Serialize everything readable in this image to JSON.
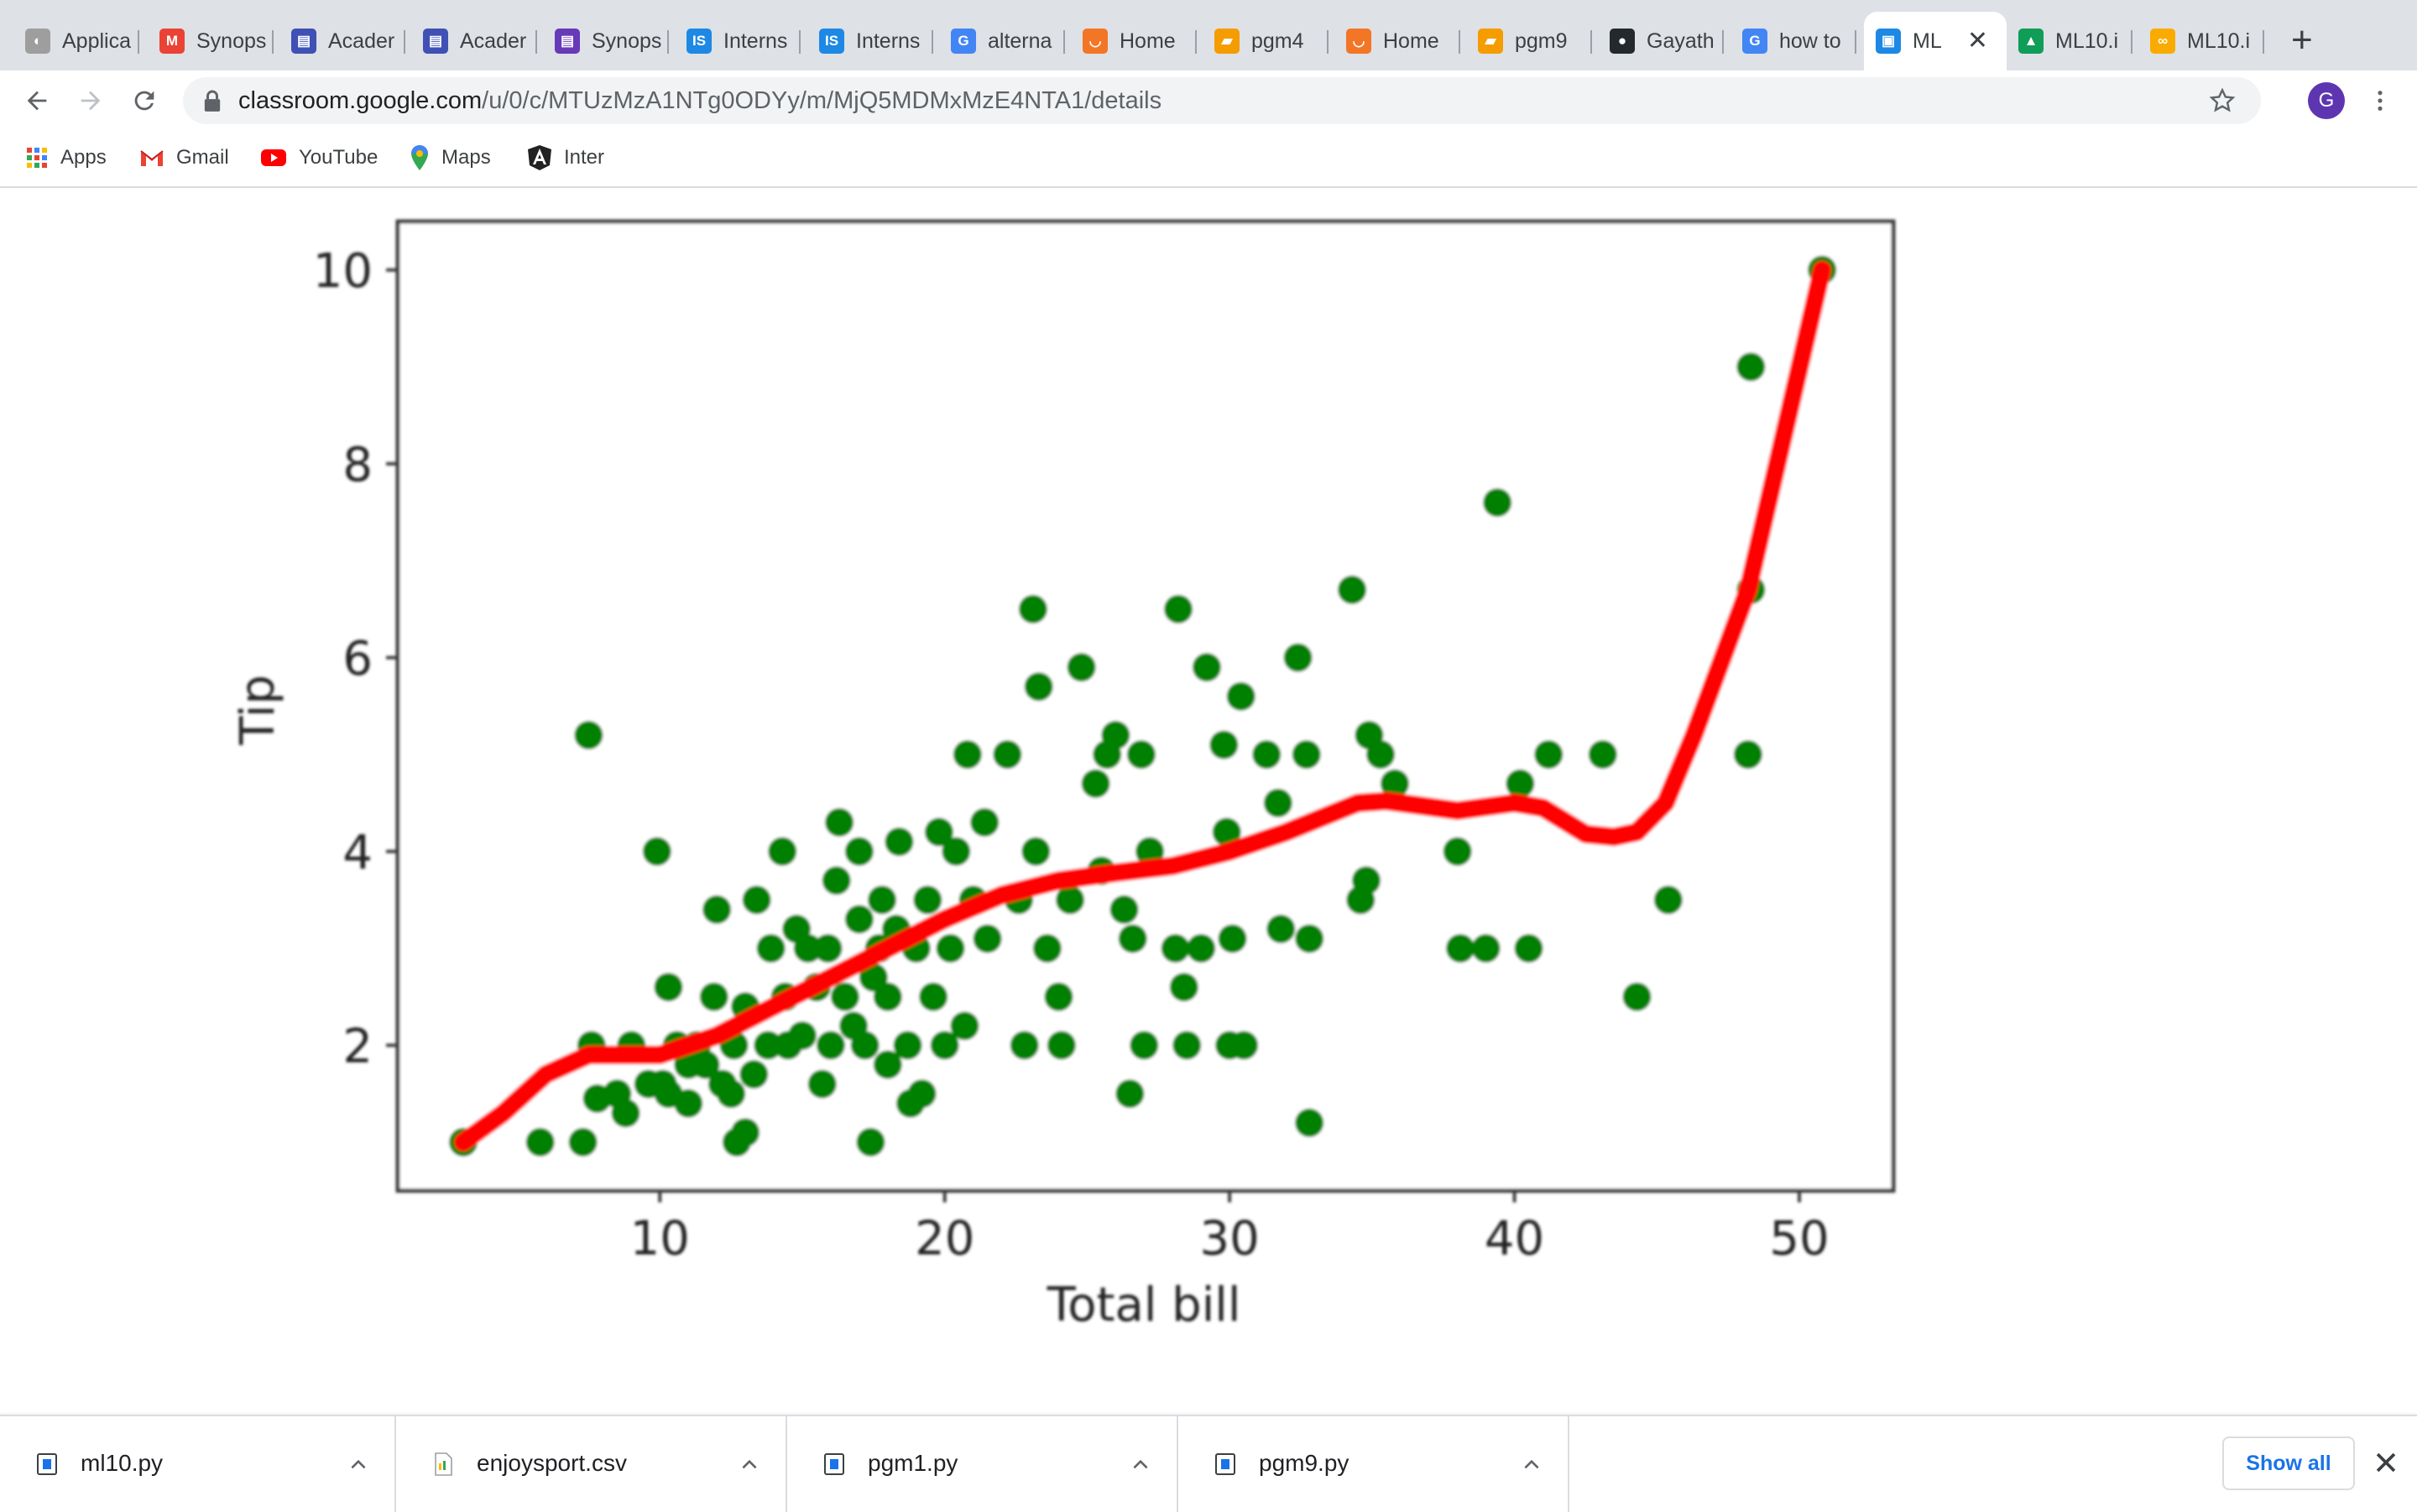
{
  "tabs": [
    {
      "label": "Applica",
      "icon": "applications-icon",
      "color": "#9e9e9e"
    },
    {
      "label": "Synops",
      "icon": "gmail-icon",
      "color": "#ea4335"
    },
    {
      "label": "Acader",
      "icon": "forms-icon",
      "color": "#3f51b5"
    },
    {
      "label": "Acader",
      "icon": "forms-icon",
      "color": "#3f51b5"
    },
    {
      "label": "Synops",
      "icon": "forms-icon",
      "color": "#673ab7"
    },
    {
      "label": "Interns",
      "icon": "internshala-icon",
      "color": "#1e88e5"
    },
    {
      "label": "Interns",
      "icon": "internshala-icon",
      "color": "#1e88e5"
    },
    {
      "label": "alterna",
      "icon": "google-icon",
      "color": "#4285f4"
    },
    {
      "label": "Home",
      "icon": "jupyter-icon",
      "color": "#f37626"
    },
    {
      "label": "pgm4",
      "icon": "notebook-icon",
      "color": "#f59c00"
    },
    {
      "label": "Home",
      "icon": "jupyter-icon",
      "color": "#f37626"
    },
    {
      "label": "pgm9",
      "icon": "notebook-icon",
      "color": "#f59c00"
    },
    {
      "label": "Gayath",
      "icon": "github-icon",
      "color": "#24292e"
    },
    {
      "label": "how to",
      "icon": "google-icon",
      "color": "#4285f4"
    },
    {
      "label": "ML",
      "icon": "classroom-icon",
      "color": "#1e88e5",
      "active": true
    },
    {
      "label": "ML10.i",
      "icon": "drive-icon",
      "color": "#0f9d58"
    },
    {
      "label": "ML10.i",
      "icon": "colab-icon",
      "color": "#f9ab00"
    }
  ],
  "address": {
    "host": "classroom.google.com",
    "path": "/u/0/c/MTUzMzA1NTg0ODYy/m/MjQ5MDMxMzE4NTA1/details"
  },
  "profile_initial": "G",
  "bookmarks": [
    {
      "label": "Apps",
      "icon": "apps-grid-icon"
    },
    {
      "label": "Gmail",
      "icon": "gmail-icon"
    },
    {
      "label": "YouTube",
      "icon": "youtube-icon"
    },
    {
      "label": "Maps",
      "icon": "maps-icon"
    },
    {
      "label": "Inter",
      "icon": "angular-icon"
    }
  ],
  "chart_data": {
    "type": "scatter",
    "xlabel": "Total bill",
    "ylabel": "Tip",
    "xlim": [
      0.8,
      53.3
    ],
    "ylim": [
      0.5,
      10.5
    ],
    "xticks": [
      10,
      20,
      30,
      40,
      50
    ],
    "yticks": [
      2,
      4,
      6,
      8,
      10
    ],
    "grid": false,
    "series": [
      {
        "kind": "scatter",
        "color": "#008000",
        "points": [
          [
            3.1,
            1.0
          ],
          [
            5.8,
            1.0
          ],
          [
            7.3,
            1.0
          ],
          [
            7.5,
            5.2
          ],
          [
            7.6,
            2.0
          ],
          [
            7.8,
            1.45
          ],
          [
            8.5,
            1.5
          ],
          [
            8.8,
            1.3
          ],
          [
            9.0,
            2.0
          ],
          [
            9.6,
            1.6
          ],
          [
            9.9,
            4.0
          ],
          [
            10.1,
            1.6
          ],
          [
            10.3,
            1.5
          ],
          [
            10.3,
            2.6
          ],
          [
            10.6,
            2.0
          ],
          [
            11.0,
            1.8
          ],
          [
            11.0,
            1.4
          ],
          [
            11.3,
            2.0
          ],
          [
            11.6,
            1.8
          ],
          [
            11.9,
            2.5
          ],
          [
            12.2,
            1.6
          ],
          [
            12.0,
            3.4
          ],
          [
            12.5,
            1.5
          ],
          [
            12.6,
            2.0
          ],
          [
            12.7,
            1.0
          ],
          [
            13.0,
            2.4
          ],
          [
            13.0,
            1.1
          ],
          [
            13.3,
            1.7
          ],
          [
            13.4,
            3.5
          ],
          [
            13.8,
            2.0
          ],
          [
            13.9,
            3.0
          ],
          [
            14.3,
            4.0
          ],
          [
            14.4,
            2.5
          ],
          [
            14.5,
            2.0
          ],
          [
            14.8,
            3.2
          ],
          [
            15.0,
            2.1
          ],
          [
            15.2,
            3.0
          ],
          [
            15.5,
            2.6
          ],
          [
            15.7,
            1.6
          ],
          [
            15.9,
            3.0
          ],
          [
            16.0,
            2.0
          ],
          [
            16.2,
            3.7
          ],
          [
            16.3,
            4.3
          ],
          [
            16.5,
            2.5
          ],
          [
            16.8,
            2.2
          ],
          [
            17.0,
            4.0
          ],
          [
            17.0,
            3.3
          ],
          [
            17.2,
            2.0
          ],
          [
            17.4,
            1.0
          ],
          [
            17.5,
            2.7
          ],
          [
            17.7,
            3.0
          ],
          [
            17.8,
            3.5
          ],
          [
            18.0,
            2.5
          ],
          [
            18.0,
            1.8
          ],
          [
            18.3,
            3.2
          ],
          [
            18.4,
            4.1
          ],
          [
            18.7,
            2.0
          ],
          [
            18.8,
            1.4
          ],
          [
            19.0,
            3.0
          ],
          [
            19.2,
            1.5
          ],
          [
            19.4,
            3.5
          ],
          [
            19.6,
            2.5
          ],
          [
            19.8,
            4.2
          ],
          [
            20.0,
            2.0
          ],
          [
            20.2,
            3.0
          ],
          [
            20.4,
            4.0
          ],
          [
            20.7,
            2.2
          ],
          [
            20.8,
            5.0
          ],
          [
            21.0,
            3.5
          ],
          [
            21.4,
            4.3
          ],
          [
            21.5,
            3.1
          ],
          [
            22.2,
            5.0
          ],
          [
            22.6,
            3.5
          ],
          [
            22.8,
            2.0
          ],
          [
            23.1,
            6.5
          ],
          [
            23.2,
            4.0
          ],
          [
            23.3,
            5.7
          ],
          [
            23.6,
            3.0
          ],
          [
            24.0,
            2.5
          ],
          [
            24.1,
            2.0
          ],
          [
            24.4,
            3.5
          ],
          [
            24.8,
            5.9
          ],
          [
            25.3,
            4.7
          ],
          [
            25.5,
            3.8
          ],
          [
            25.7,
            5.0
          ],
          [
            26.0,
            5.2
          ],
          [
            26.3,
            3.4
          ],
          [
            26.5,
            1.5
          ],
          [
            26.6,
            3.1
          ],
          [
            26.9,
            5.0
          ],
          [
            27.0,
            2.0
          ],
          [
            27.2,
            4.0
          ],
          [
            28.1,
            3.0
          ],
          [
            28.2,
            6.5
          ],
          [
            28.4,
            2.6
          ],
          [
            28.5,
            2.0
          ],
          [
            29.0,
            3.0
          ],
          [
            29.2,
            5.9
          ],
          [
            29.8,
            5.1
          ],
          [
            29.9,
            4.2
          ],
          [
            30.0,
            2.0
          ],
          [
            30.1,
            3.1
          ],
          [
            30.4,
            5.6
          ],
          [
            30.5,
            2.0
          ],
          [
            31.3,
            5.0
          ],
          [
            31.7,
            4.5
          ],
          [
            31.8,
            3.2
          ],
          [
            32.4,
            6.0
          ],
          [
            32.7,
            5.0
          ],
          [
            32.8,
            3.1
          ],
          [
            32.8,
            1.2
          ],
          [
            34.3,
            6.7
          ],
          [
            34.6,
            3.5
          ],
          [
            34.8,
            3.7
          ],
          [
            34.9,
            5.2
          ],
          [
            35.3,
            5.0
          ],
          [
            35.8,
            4.7
          ],
          [
            38.0,
            4.0
          ],
          [
            38.1,
            3.0
          ],
          [
            39.0,
            3.0
          ],
          [
            39.4,
            7.6
          ],
          [
            40.2,
            4.7
          ],
          [
            40.5,
            3.0
          ],
          [
            41.2,
            5.0
          ],
          [
            43.1,
            5.0
          ],
          [
            44.3,
            2.5
          ],
          [
            45.4,
            3.5
          ],
          [
            48.2,
            5.0
          ],
          [
            48.3,
            6.7
          ],
          [
            48.3,
            9.0
          ],
          [
            50.8,
            10.0
          ]
        ]
      },
      {
        "kind": "line",
        "color": "#ff0000",
        "points": [
          [
            3.1,
            1.0
          ],
          [
            4.5,
            1.3
          ],
          [
            6.0,
            1.7
          ],
          [
            7.5,
            1.9
          ],
          [
            10.0,
            1.9
          ],
          [
            12.0,
            2.1
          ],
          [
            14.0,
            2.4
          ],
          [
            16.0,
            2.7
          ],
          [
            18.0,
            3.0
          ],
          [
            20.0,
            3.3
          ],
          [
            22.0,
            3.55
          ],
          [
            24.0,
            3.7
          ],
          [
            26.0,
            3.78
          ],
          [
            28.0,
            3.85
          ],
          [
            30.0,
            4.0
          ],
          [
            32.0,
            4.2
          ],
          [
            34.5,
            4.5
          ],
          [
            35.5,
            4.52
          ],
          [
            38.0,
            4.42
          ],
          [
            40.0,
            4.5
          ],
          [
            41.0,
            4.45
          ],
          [
            42.5,
            4.18
          ],
          [
            43.5,
            4.15
          ],
          [
            44.3,
            4.2
          ],
          [
            45.3,
            4.5
          ],
          [
            46.3,
            5.2
          ],
          [
            48.2,
            6.7
          ],
          [
            50.8,
            10.0
          ]
        ]
      }
    ]
  },
  "downloads": [
    {
      "name": "ml10.py",
      "icon": "python-file-icon"
    },
    {
      "name": "enjoysport.csv",
      "icon": "csv-file-icon"
    },
    {
      "name": "pgm1.py",
      "icon": "python-file-icon"
    },
    {
      "name": "pgm9.py",
      "icon": "python-file-icon"
    }
  ],
  "show_all_label": "Show all"
}
